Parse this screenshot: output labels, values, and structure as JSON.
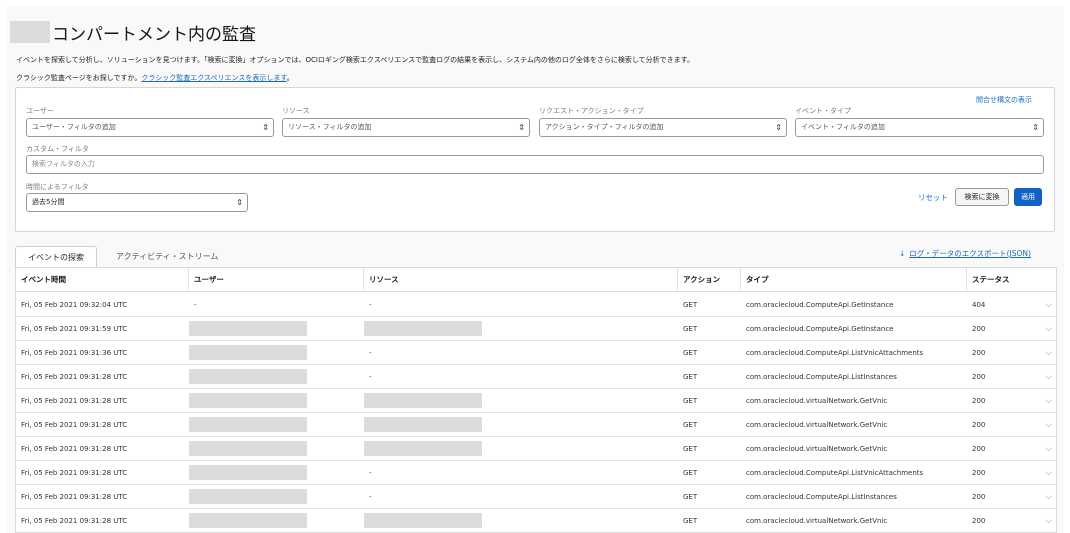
{
  "header": {
    "title": "コンパートメント内の監査",
    "description": "イベントを探索して分析し、ソリューションを見つけます。「検索に変換」オプションでは、OCIロギング検索エクスペリエンスで監査ログの結果を表示し、システム内の他のログ全体をさらに検索して分析できます。",
    "classic_prefix": "クラシック監査ページをお探しですか。",
    "classic_link": "クラシック監査エクスペリエンスを表示します",
    "classic_suffix": "。"
  },
  "filters": {
    "query_syntax_link": "問合せ構文の表示",
    "user": {
      "label": "ユーザー",
      "placeholder": "ユーザー・フィルタの追加"
    },
    "resource": {
      "label": "リソース",
      "placeholder": "リソース・フィルタの追加"
    },
    "request_action": {
      "label": "リクエスト・アクション・タイプ",
      "placeholder": "アクション・タイプ・フィルタの追加"
    },
    "event_type": {
      "label": "イベント・タイプ",
      "placeholder": "イベント・フィルタの追加"
    },
    "custom": {
      "label": "カスタム・フィルタ",
      "placeholder": "検索フィルタの入力"
    },
    "time": {
      "label": "時間によるフィルタ",
      "value": "過去5分間"
    },
    "reset": "リセット",
    "convert": "検索に変換",
    "apply": "適用"
  },
  "tabs": [
    {
      "label": "イベントの探索",
      "active": true
    },
    {
      "label": "アクティビティ・ストリーム",
      "active": false
    }
  ],
  "export_link": "ログ・データのエクスポート(JSON)",
  "table": {
    "columns": [
      "イベント時間",
      "ユーザー",
      "リソース",
      "アクション",
      "タイプ",
      "ステータス"
    ],
    "rows": [
      {
        "time": "Fri, 05 Feb 2021 09:32:04 UTC",
        "user": "-",
        "resource": "-",
        "action": "GET",
        "type": "com.oraclecloud.ComputeApi.GetInstance",
        "status": "404"
      },
      {
        "time": "Fri, 05 Feb 2021 09:31:59 UTC",
        "user": "",
        "resource": "",
        "action": "GET",
        "type": "com.oraclecloud.ComputeApi.GetInstance",
        "status": "200"
      },
      {
        "time": "Fri, 05 Feb 2021 09:31:36 UTC",
        "user": "",
        "resource": "-",
        "action": "GET",
        "type": "com.oraclecloud.ComputeApi.ListVnicAttachments",
        "status": "200"
      },
      {
        "time": "Fri, 05 Feb 2021 09:31:28 UTC",
        "user": "",
        "resource": "-",
        "action": "GET",
        "type": "com.oraclecloud.ComputeApi.ListInstances",
        "status": "200"
      },
      {
        "time": "Fri, 05 Feb 2021 09:31:28 UTC",
        "user": "",
        "resource": "",
        "action": "GET",
        "type": "com.oraclecloud.virtualNetwork.GetVnic",
        "status": "200"
      },
      {
        "time": "Fri, 05 Feb 2021 09:31:28 UTC",
        "user": "",
        "resource": "",
        "action": "GET",
        "type": "com.oraclecloud.virtualNetwork.GetVnic",
        "status": "200"
      },
      {
        "time": "Fri, 05 Feb 2021 09:31:28 UTC",
        "user": "",
        "resource": "",
        "action": "GET",
        "type": "com.oraclecloud.virtualNetwork.GetVnic",
        "status": "200"
      },
      {
        "time": "Fri, 05 Feb 2021 09:31:28 UTC",
        "user": "",
        "resource": "-",
        "action": "GET",
        "type": "com.oraclecloud.ComputeApi.ListVnicAttachments",
        "status": "200"
      },
      {
        "time": "Fri, 05 Feb 2021 09:31:28 UTC",
        "user": "",
        "resource": "-",
        "action": "GET",
        "type": "com.oraclecloud.ComputeApi.ListInstances",
        "status": "200"
      },
      {
        "time": "Fri, 05 Feb 2021 09:31:28 UTC",
        "user": "",
        "resource": "",
        "action": "GET",
        "type": "com.oraclecloud.virtualNetwork.GetVnic",
        "status": "200"
      }
    ]
  },
  "icons": {
    "select_chevron": "updown-chevron-icon",
    "row_expand": "chevron-down-icon",
    "export": "download-arrow-icon"
  },
  "colors": {
    "primary": "#1261c7",
    "link": "#1a6ac0"
  }
}
